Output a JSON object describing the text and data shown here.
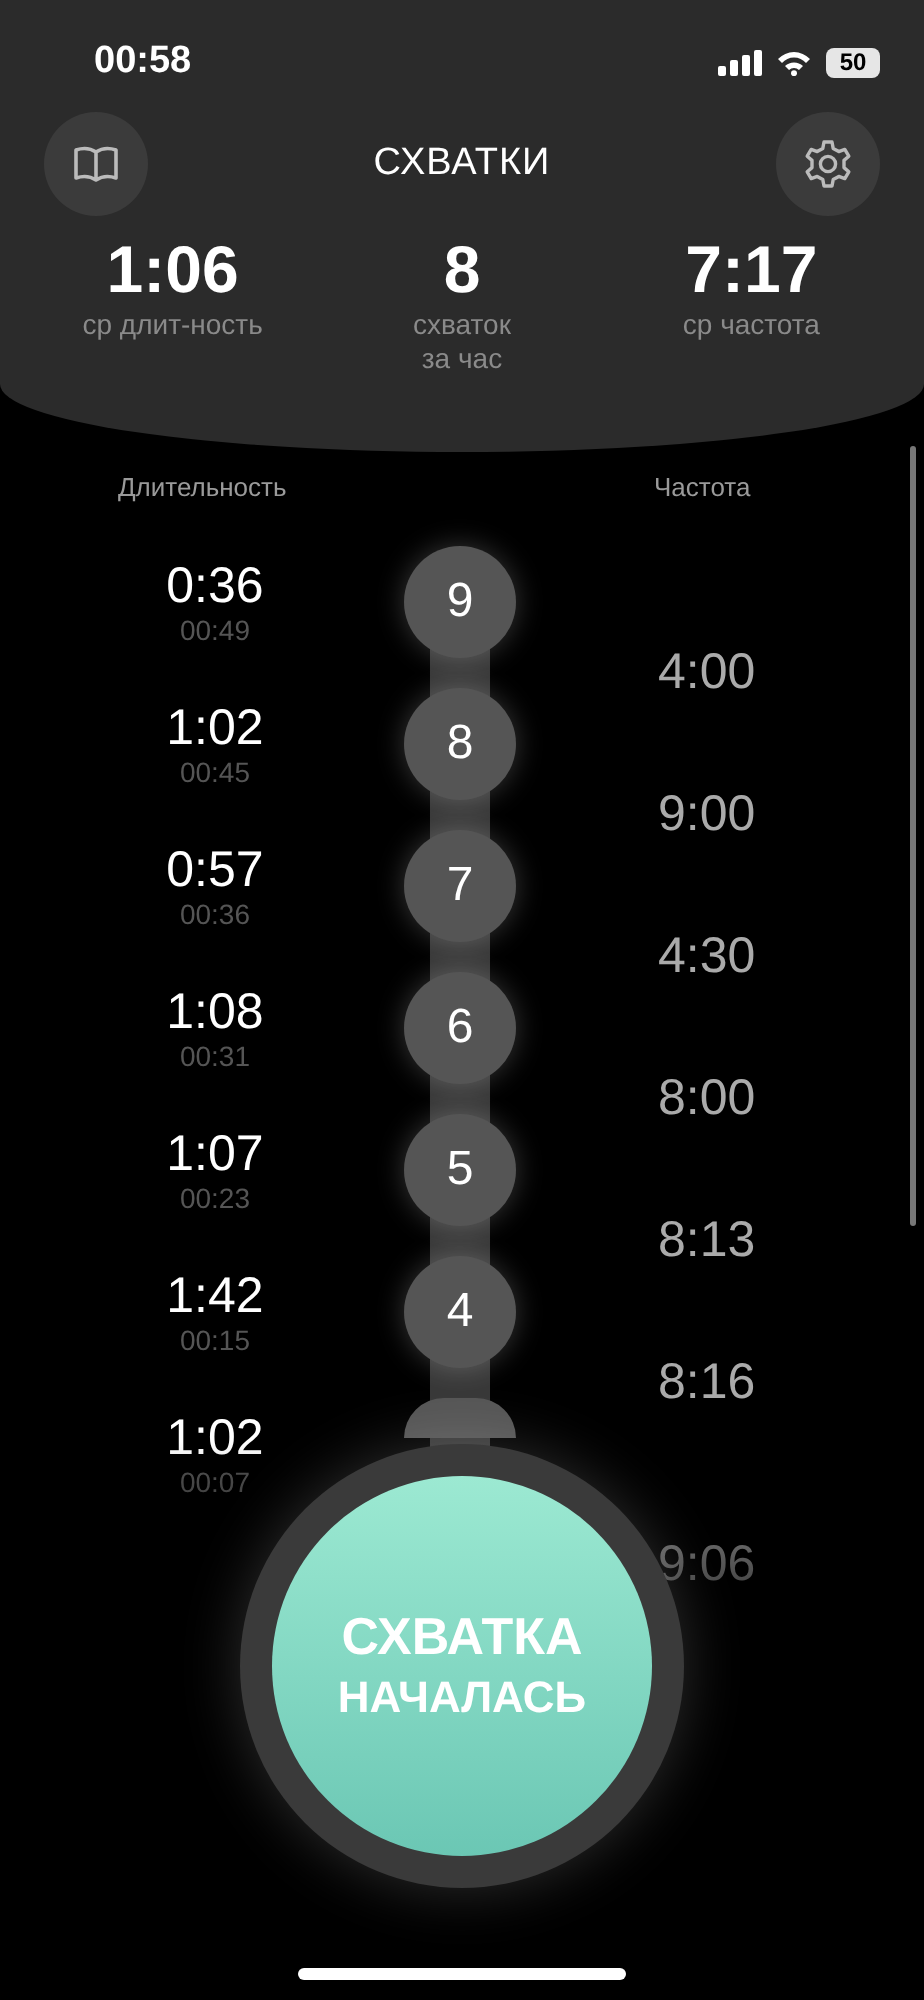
{
  "status_bar": {
    "time": "00:58",
    "battery": "50"
  },
  "header": {
    "title": "СХВАТКИ"
  },
  "stats": [
    {
      "value": "1:06",
      "label": "ср длит-ность"
    },
    {
      "value": "8",
      "label": "схваток за час"
    },
    {
      "value": "7:17",
      "label": "ср частота"
    }
  ],
  "columns": {
    "duration": "Длительность",
    "frequency": "Частота"
  },
  "rows": [
    {
      "duration": "0:36",
      "time": "00:49",
      "number": "9"
    },
    {
      "duration": "1:02",
      "time": "00:45",
      "number": "8"
    },
    {
      "duration": "0:57",
      "time": "00:36",
      "number": "7"
    },
    {
      "duration": "1:08",
      "time": "00:31",
      "number": "6"
    },
    {
      "duration": "1:07",
      "time": "00:23",
      "number": "5"
    },
    {
      "duration": "1:42",
      "time": "00:15",
      "number": "4"
    },
    {
      "duration": "1:02",
      "time": "00:07"
    }
  ],
  "frequencies": [
    "4:00",
    "9:00",
    "4:30",
    "8:00",
    "8:13",
    "8:16",
    "9:06"
  ],
  "main_button": {
    "line_1": "СХВАТКА",
    "line_2": "НАЧАЛАСЬ"
  }
}
